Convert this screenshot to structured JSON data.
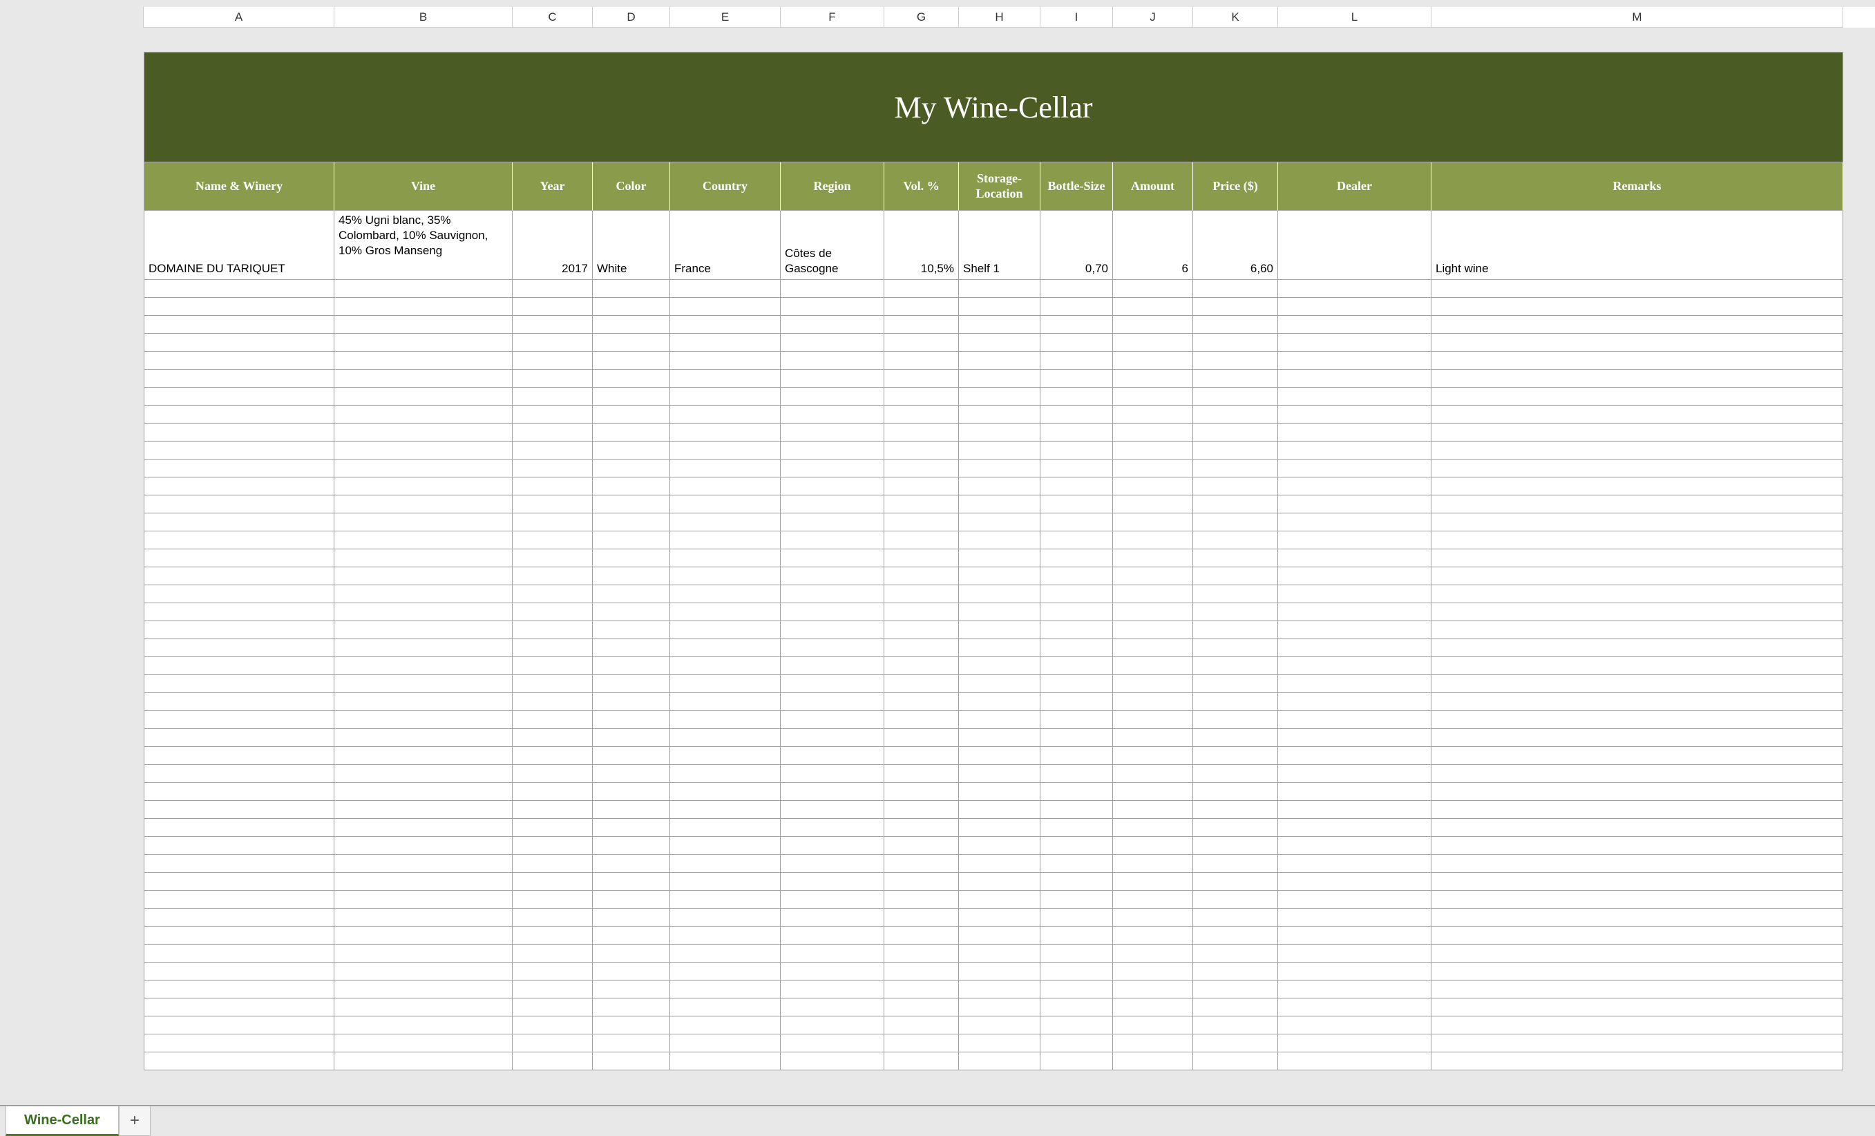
{
  "column_letters": [
    "A",
    "B",
    "C",
    "D",
    "E",
    "F",
    "G",
    "H",
    "I",
    "J",
    "K",
    "L",
    "M"
  ],
  "title": "My Wine-Cellar",
  "headers": {
    "name_winery": "Name & Winery",
    "vine": "Vine",
    "year": "Year",
    "color": "Color",
    "country": "Country",
    "region": "Region",
    "vol": "Vol. %",
    "storage_location": "Storage-Location",
    "bottle_size": "Bottle-Size",
    "amount": "Amount",
    "price": "Price ($)",
    "dealer": "Dealer",
    "remarks": "Remarks"
  },
  "rows": [
    {
      "name_winery": "DOMAINE DU TARIQUET",
      "vine": "45% Ugni blanc, 35% Colombard, 10% Sauvignon, 10% Gros Manseng",
      "year": "2017",
      "color": "White",
      "country": "France",
      "region": "Côtes de Gascogne",
      "vol": "10,5%",
      "storage_location": "Shelf 1",
      "bottle_size": "0,70",
      "amount": "6",
      "price": "6,60",
      "dealer": "",
      "remarks": "Light wine"
    }
  ],
  "empty_row_count": 44,
  "tabs": {
    "active": "Wine-Cellar",
    "add_icon": "+"
  },
  "colors": {
    "title_bg": "#4a5b23",
    "header_bg": "#8b9b4c",
    "tab_accent": "#3a6f1f"
  }
}
